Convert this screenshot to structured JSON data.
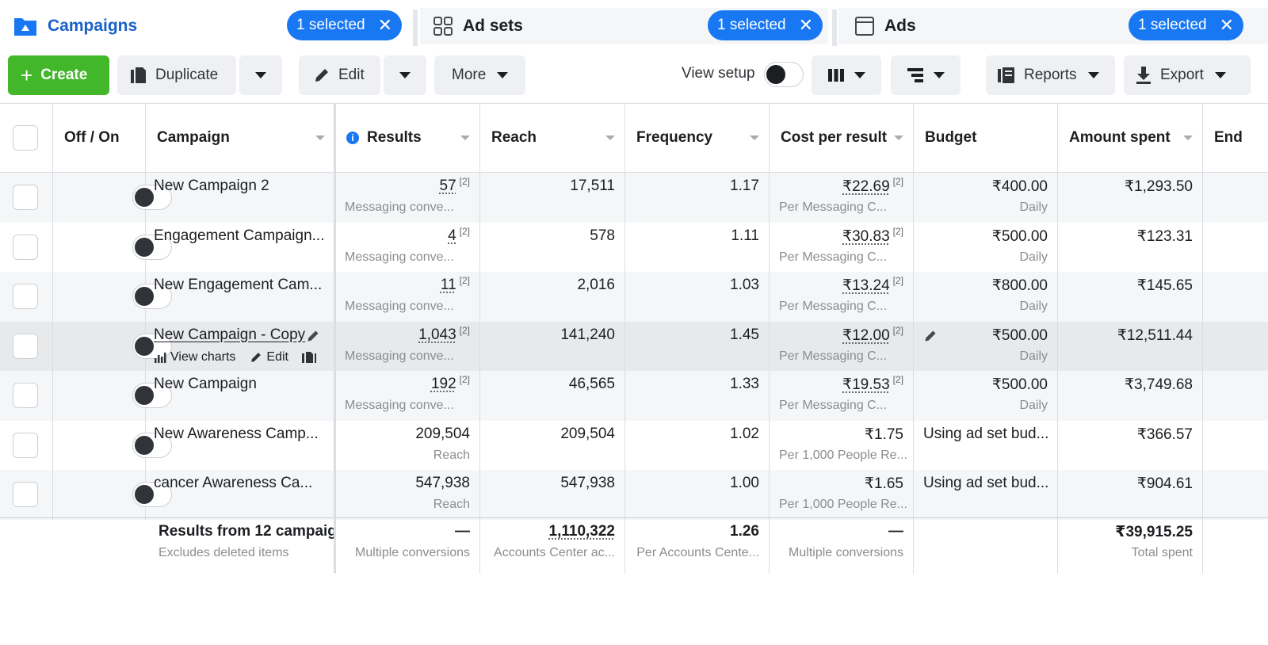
{
  "tabs": {
    "campaigns": {
      "title": "Campaigns",
      "selected": "1 selected"
    },
    "adsets": {
      "title": "Ad sets",
      "selected": "1 selected"
    },
    "ads": {
      "title": "Ads",
      "selected": "1 selected"
    }
  },
  "toolbar": {
    "create": "Create",
    "duplicate": "Duplicate",
    "edit": "Edit",
    "more": "More",
    "view_setup": "View setup",
    "reports": "Reports",
    "export": "Export"
  },
  "columns": [
    "Off / On",
    "Campaign",
    "Results",
    "Reach",
    "Frequency",
    "Cost per result",
    "Budget",
    "Amount spent",
    "End"
  ],
  "rows": [
    {
      "campaign": "New Campaign 2",
      "results": "57",
      "results_sub": "Messaging conve...",
      "reach": "17,511",
      "frequency": "1.17",
      "cpr": "₹22.69",
      "cpr_sub": "Per Messaging C...",
      "budget": "₹400.00",
      "budget_sub": "Daily",
      "spent": "₹1,293.50"
    },
    {
      "campaign": "Engagement Campaign...",
      "results": "4",
      "results_sub": "Messaging conve...",
      "reach": "578",
      "frequency": "1.11",
      "cpr": "₹30.83",
      "cpr_sub": "Per Messaging C...",
      "budget": "₹500.00",
      "budget_sub": "Daily",
      "spent": "₹123.31"
    },
    {
      "campaign": "New Engagement Cam...",
      "results": "11",
      "results_sub": "Messaging conve...",
      "reach": "2,016",
      "frequency": "1.03",
      "cpr": "₹13.24",
      "cpr_sub": "Per Messaging C...",
      "budget": "₹800.00",
      "budget_sub": "Daily",
      "spent": "₹145.65"
    },
    {
      "campaign": "New Campaign - Copy",
      "results": "1,043",
      "results_sub": "Messaging conve...",
      "reach": "141,240",
      "frequency": "1.45",
      "cpr": "₹12.00",
      "cpr_sub": "Per Messaging C...",
      "budget": "₹500.00",
      "budget_sub": "Daily",
      "spent": "₹12,511.44",
      "view_charts": "View charts",
      "edit": "Edit"
    },
    {
      "campaign": "New Campaign",
      "results": "192",
      "results_sub": "Messaging conve...",
      "reach": "46,565",
      "frequency": "1.33",
      "cpr": "₹19.53",
      "cpr_sub": "Per Messaging C...",
      "budget": "₹500.00",
      "budget_sub": "Daily",
      "spent": "₹3,749.68"
    },
    {
      "campaign": "New Awareness Camp...",
      "results": "209,504",
      "results_sub": "Reach",
      "reach": "209,504",
      "frequency": "1.02",
      "cpr": "₹1.75",
      "cpr_sub": "Per 1,000 People Re...",
      "budget": "Using ad set bud...",
      "budget_sub": "",
      "spent": "₹366.57"
    },
    {
      "campaign": "cancer Awareness Ca...",
      "results": "547,938",
      "results_sub": "Reach",
      "reach": "547,938",
      "frequency": "1.00",
      "cpr": "₹1.65",
      "cpr_sub": "Per 1,000 People Re...",
      "budget": "Using ad set bud...",
      "budget_sub": "",
      "spent": "₹904.61"
    }
  ],
  "sup_marker": "[2]",
  "footer": {
    "title": "Results from 12 campaig",
    "subtitle": "Excludes deleted items",
    "results": "—",
    "results_sub": "Multiple conversions",
    "reach": "1,110,322",
    "reach_sub": "Accounts Center ac...",
    "frequency": "1.26",
    "frequency_sub": "Per Accounts Cente...",
    "cpr": "—",
    "cpr_sub": "Multiple conversions",
    "spent": "₹39,915.25",
    "spent_sub": "Total spent"
  },
  "colors": {
    "accent": "#1877f2",
    "link": "#1861c7",
    "create": "#42b72a"
  }
}
